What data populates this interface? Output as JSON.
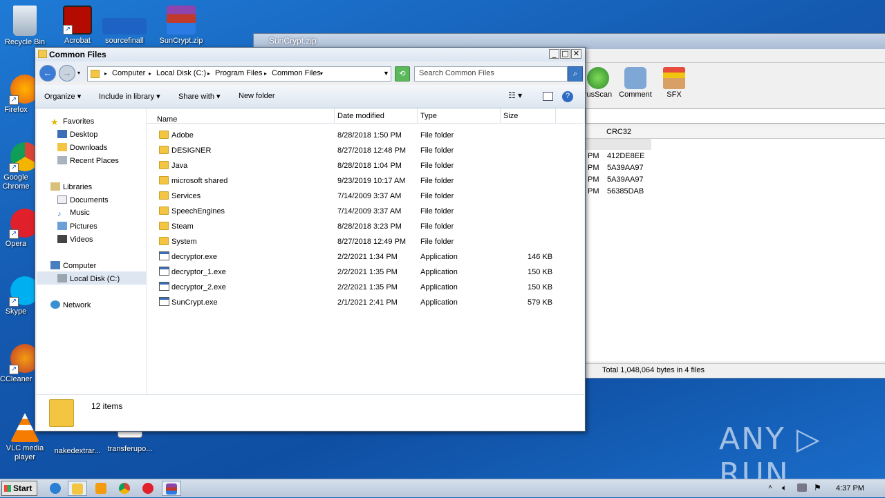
{
  "desktop": {
    "icons": [
      {
        "label": "Recycle Bin"
      },
      {
        "label": "Acrobat"
      },
      {
        "label": "sourcefinall"
      },
      {
        "label": "SunCrypt.zip"
      },
      {
        "label": "Firefox"
      },
      {
        "label": "Google Chrome"
      },
      {
        "label": "Opera"
      },
      {
        "label": "Skype"
      },
      {
        "label": "CCleaner"
      },
      {
        "label": "VLC media player"
      },
      {
        "label": "nakedextrar..."
      },
      {
        "label": "transferupo..."
      }
    ],
    "watermark": "ANY ▷ RUN"
  },
  "rar": {
    "title": "SunCrypt.zip",
    "tools": [
      {
        "label": "rusScan"
      },
      {
        "label": "Comment"
      },
      {
        "label": "SFX"
      }
    ],
    "column": "CRC32",
    "rows": [
      {
        "pm": "PM",
        "crc": "412DE8EE"
      },
      {
        "pm": "PM",
        "crc": "5A39AA97"
      },
      {
        "pm": "PM",
        "crc": "5A39AA97"
      },
      {
        "pm": "PM",
        "crc": "56385DAB"
      }
    ],
    "status": "Total 1,048,064 bytes in 4 files"
  },
  "explorer": {
    "title": "Common Files",
    "breadcrumb": [
      "Computer",
      "Local Disk (C:)",
      "Program Files",
      "Common Files"
    ],
    "search_placeholder": "Search Common Files",
    "commands": {
      "organize": "Organize",
      "include": "Include in library",
      "share": "Share with",
      "newfolder": "New folder"
    },
    "nav": {
      "favorites": "Favorites",
      "desktop": "Desktop",
      "downloads": "Downloads",
      "recent": "Recent Places",
      "libraries": "Libraries",
      "documents": "Documents",
      "music": "Music",
      "pictures": "Pictures",
      "videos": "Videos",
      "computer": "Computer",
      "localdisk": "Local Disk (C:)",
      "network": "Network"
    },
    "columns": {
      "name": "Name",
      "date": "Date modified",
      "type": "Type",
      "size": "Size"
    },
    "files": [
      {
        "name": "Adobe",
        "date": "8/28/2018 1:50 PM",
        "type": "File folder",
        "size": "",
        "kind": "folder"
      },
      {
        "name": "DESIGNER",
        "date": "8/27/2018 12:48 PM",
        "type": "File folder",
        "size": "",
        "kind": "folder"
      },
      {
        "name": "Java",
        "date": "8/28/2018 1:04 PM",
        "type": "File folder",
        "size": "",
        "kind": "folder"
      },
      {
        "name": "microsoft shared",
        "date": "9/23/2019 10:17 AM",
        "type": "File folder",
        "size": "",
        "kind": "folder"
      },
      {
        "name": "Services",
        "date": "7/14/2009 3:37 AM",
        "type": "File folder",
        "size": "",
        "kind": "folder"
      },
      {
        "name": "SpeechEngines",
        "date": "7/14/2009 3:37 AM",
        "type": "File folder",
        "size": "",
        "kind": "folder"
      },
      {
        "name": "Steam",
        "date": "8/28/2018 3:23 PM",
        "type": "File folder",
        "size": "",
        "kind": "folder"
      },
      {
        "name": "System",
        "date": "8/27/2018 12:49 PM",
        "type": "File folder",
        "size": "",
        "kind": "folder"
      },
      {
        "name": "decryptor.exe",
        "date": "2/2/2021 1:34 PM",
        "type": "Application",
        "size": "146 KB",
        "kind": "exe"
      },
      {
        "name": "decryptor_1.exe",
        "date": "2/2/2021 1:35 PM",
        "type": "Application",
        "size": "150 KB",
        "kind": "exe"
      },
      {
        "name": "decryptor_2.exe",
        "date": "2/2/2021 1:35 PM",
        "type": "Application",
        "size": "150 KB",
        "kind": "exe"
      },
      {
        "name": "SunCrypt.exe",
        "date": "2/1/2021 2:41 PM",
        "type": "Application",
        "size": "579 KB",
        "kind": "exe"
      }
    ],
    "item_count": "12 items"
  },
  "taskbar": {
    "start": "Start",
    "clock": "4:37 PM"
  }
}
